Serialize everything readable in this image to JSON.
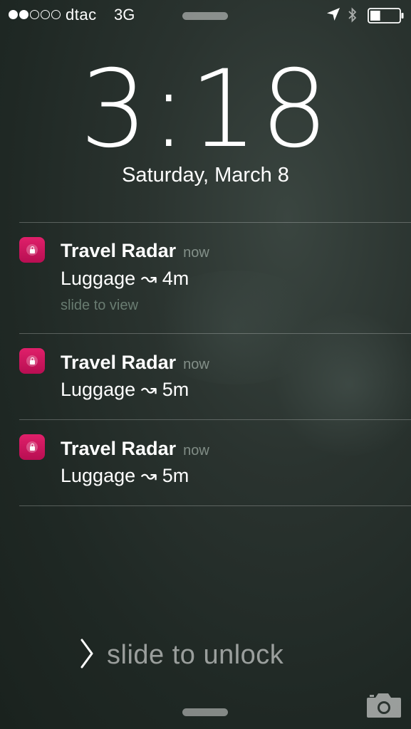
{
  "status_bar": {
    "signal": {
      "filled": 2,
      "total": 5
    },
    "carrier": "dtac",
    "network": "3G",
    "icons": [
      "location-arrow-icon",
      "bluetooth-icon",
      "battery-icon"
    ],
    "battery_level_fraction": 0.35
  },
  "lock": {
    "time": "3:18",
    "date": "Saturday, March 8"
  },
  "notifications": [
    {
      "app": "Travel Radar",
      "time": "now",
      "message": "Luggage ↝ 4m",
      "hint": "slide to view",
      "icon": "travel-radar-app-icon"
    },
    {
      "app": "Travel Radar",
      "time": "now",
      "message": "Luggage ↝ 5m",
      "icon": "travel-radar-app-icon"
    },
    {
      "app": "Travel Radar",
      "time": "now",
      "message": "Luggage ↝ 5m",
      "icon": "travel-radar-app-icon"
    }
  ],
  "unlock": {
    "text": "slide to unlock",
    "icon": "chevron-right-icon"
  },
  "camera": {
    "icon": "camera-icon"
  },
  "colors": {
    "app_icon": "#d01862",
    "background": "#232c28"
  }
}
